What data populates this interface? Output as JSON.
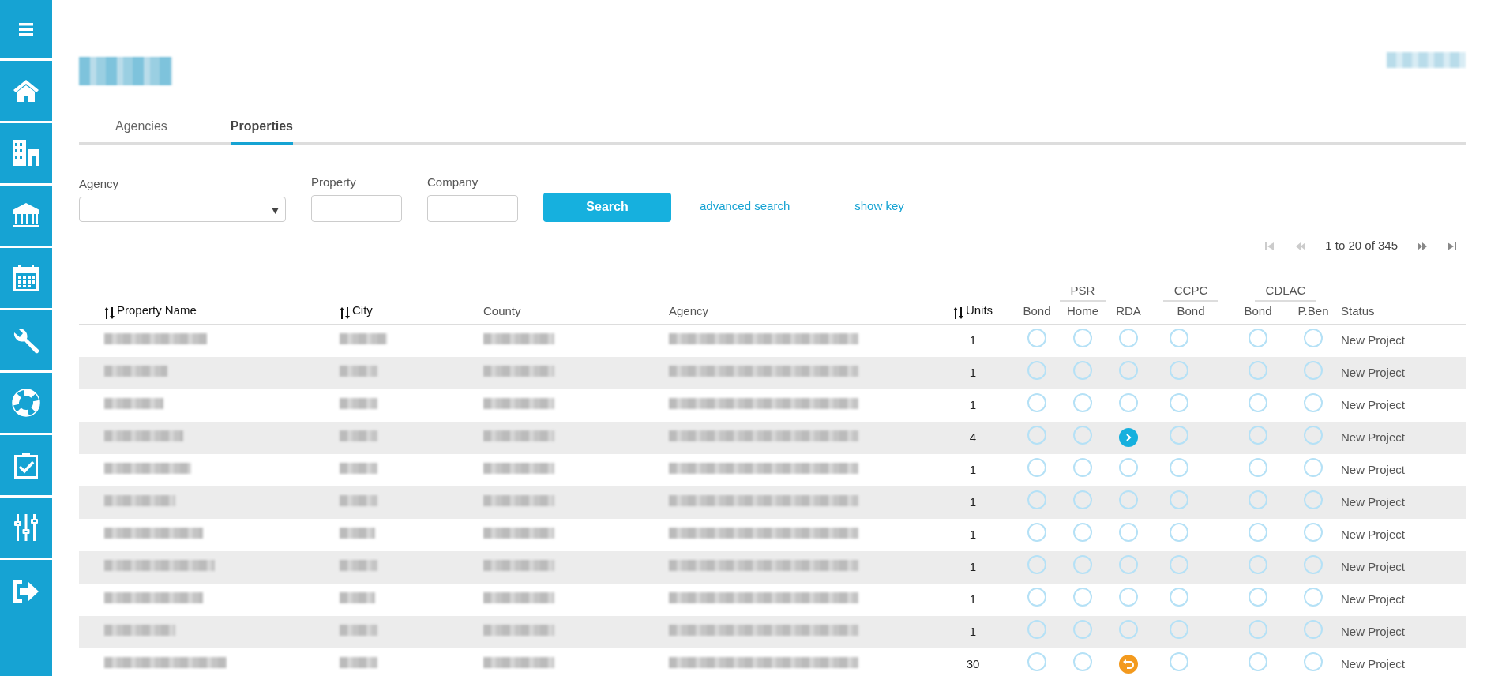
{
  "sidebar": {
    "items": [
      {
        "kind": "menu"
      },
      {
        "kind": "home"
      },
      {
        "kind": "buildings"
      },
      {
        "kind": "bank"
      },
      {
        "kind": "calendar"
      },
      {
        "kind": "wrench"
      },
      {
        "kind": "lifebuoy"
      },
      {
        "kind": "clipboard"
      },
      {
        "kind": "sliders"
      },
      {
        "kind": "logout"
      }
    ]
  },
  "tabs": [
    {
      "label": "Agencies",
      "selected": false
    },
    {
      "label": "Properties",
      "selected": true
    }
  ],
  "search_form": {
    "fields": [
      {
        "label": "Agency",
        "kind": "select"
      },
      {
        "label": "Property",
        "kind": "text"
      },
      {
        "label": "Company",
        "kind": "text"
      }
    ],
    "button": "Search",
    "links": [
      "advanced search",
      "show key"
    ]
  },
  "pagination": {
    "summary": "1 to 20 of 345",
    "first_disabled": true,
    "prev_disabled": true,
    "next_disabled": false,
    "last_disabled": false
  },
  "table": {
    "columns": [
      {
        "label": "Property Name",
        "sortable": true
      },
      {
        "label": "City",
        "sortable": true
      },
      {
        "label": "County",
        "sortable": false
      },
      {
        "label": "Agency",
        "sortable": false
      },
      {
        "label": "Units",
        "sortable": true
      }
    ],
    "groups": [
      {
        "label": "PSR",
        "subcolumns": [
          "Bond",
          "Home",
          "RDA"
        ]
      },
      {
        "label": "CCPC",
        "subcolumns": [
          "Bond"
        ]
      },
      {
        "label": "CDLAC",
        "subcolumns": [
          "Bond",
          "P.Ben"
        ]
      }
    ],
    "status_column": "Status",
    "rows": [
      {
        "units": "1",
        "marks": [
          {
            "kind": "empty"
          },
          {
            "kind": "empty"
          },
          {
            "kind": "empty"
          },
          {
            "kind": "empty"
          },
          {
            "kind": "empty"
          },
          {
            "kind": "empty"
          }
        ],
        "status": "New Project"
      },
      {
        "units": "1",
        "marks": [
          {
            "kind": "empty"
          },
          {
            "kind": "empty"
          },
          {
            "kind": "empty"
          },
          {
            "kind": "empty"
          },
          {
            "kind": "empty"
          },
          {
            "kind": "empty"
          }
        ],
        "status": "New Project"
      },
      {
        "units": "1",
        "marks": [
          {
            "kind": "empty"
          },
          {
            "kind": "empty"
          },
          {
            "kind": "empty"
          },
          {
            "kind": "empty"
          },
          {
            "kind": "empty"
          },
          {
            "kind": "empty"
          }
        ],
        "status": "New Project"
      },
      {
        "units": "4",
        "marks": [
          {
            "kind": "empty"
          },
          {
            "kind": "empty"
          },
          {
            "kind": "forward"
          },
          {
            "kind": "empty"
          },
          {
            "kind": "empty"
          },
          {
            "kind": "empty"
          }
        ],
        "status": "New Project"
      },
      {
        "units": "1",
        "marks": [
          {
            "kind": "empty"
          },
          {
            "kind": "empty"
          },
          {
            "kind": "empty"
          },
          {
            "kind": "empty"
          },
          {
            "kind": "empty"
          },
          {
            "kind": "empty"
          }
        ],
        "status": "New Project"
      },
      {
        "units": "1",
        "marks": [
          {
            "kind": "empty"
          },
          {
            "kind": "empty"
          },
          {
            "kind": "empty"
          },
          {
            "kind": "empty"
          },
          {
            "kind": "empty"
          },
          {
            "kind": "empty"
          }
        ],
        "status": "New Project"
      },
      {
        "units": "1",
        "marks": [
          {
            "kind": "empty"
          },
          {
            "kind": "empty"
          },
          {
            "kind": "empty"
          },
          {
            "kind": "empty"
          },
          {
            "kind": "empty"
          },
          {
            "kind": "empty"
          }
        ],
        "status": "New Project"
      },
      {
        "units": "1",
        "marks": [
          {
            "kind": "empty"
          },
          {
            "kind": "empty"
          },
          {
            "kind": "empty"
          },
          {
            "kind": "empty"
          },
          {
            "kind": "empty"
          },
          {
            "kind": "empty"
          }
        ],
        "status": "New Project"
      },
      {
        "units": "1",
        "marks": [
          {
            "kind": "empty"
          },
          {
            "kind": "empty"
          },
          {
            "kind": "empty"
          },
          {
            "kind": "empty"
          },
          {
            "kind": "empty"
          },
          {
            "kind": "empty"
          }
        ],
        "status": "New Project"
      },
      {
        "units": "1",
        "marks": [
          {
            "kind": "empty"
          },
          {
            "kind": "empty"
          },
          {
            "kind": "empty"
          },
          {
            "kind": "empty"
          },
          {
            "kind": "empty"
          },
          {
            "kind": "empty"
          }
        ],
        "status": "New Project"
      },
      {
        "units": "30",
        "marks": [
          {
            "kind": "empty"
          },
          {
            "kind": "empty"
          },
          {
            "kind": "returned"
          },
          {
            "kind": "empty"
          },
          {
            "kind": "empty"
          },
          {
            "kind": "empty"
          }
        ],
        "status": "New Project"
      }
    ]
  }
}
